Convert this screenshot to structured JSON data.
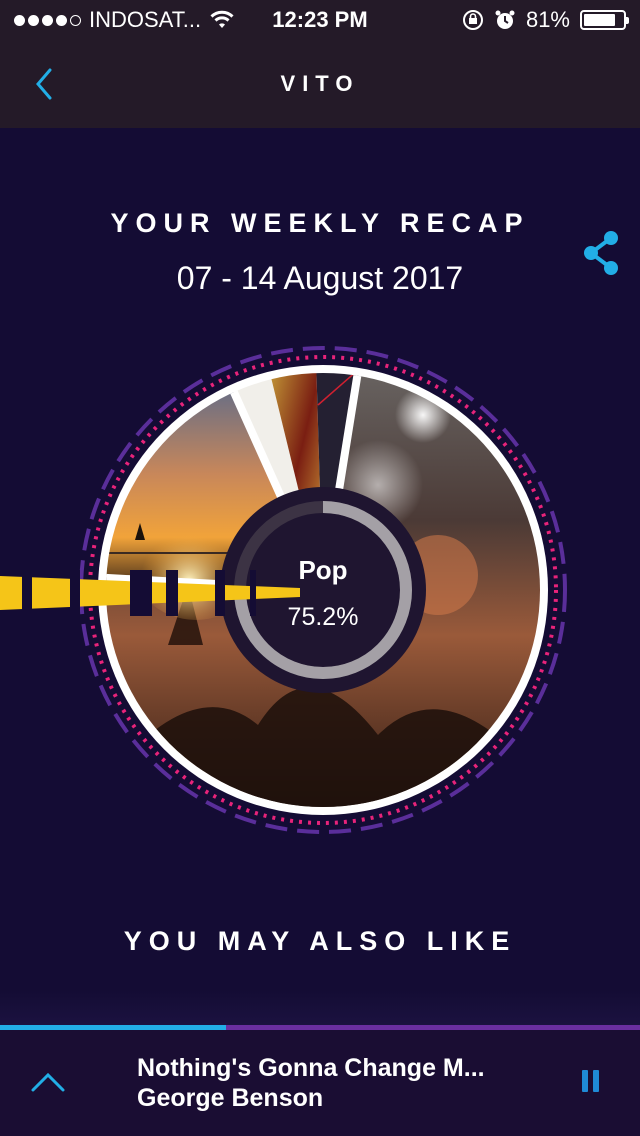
{
  "status": {
    "carrier": "INDOSAT...",
    "time": "12:23 PM",
    "battery": "81%",
    "battery_level": 0.81,
    "signal_bars": 4,
    "icons": [
      "wifi-icon",
      "rotation-lock-icon",
      "alarm-icon"
    ]
  },
  "nav": {
    "title": "VITO",
    "back_icon": "chevron-left-icon"
  },
  "recap": {
    "title": "YOUR WEEKLY RECAP",
    "date_range": "07 - 14 August 2017",
    "share_icon": "share-icon"
  },
  "genre": {
    "name": "Pop",
    "percent": "75.2%",
    "percent_value": 0.752
  },
  "sections": {
    "also_like": "YOU MAY ALSO LIKE"
  },
  "player": {
    "title": "Nothing's Gonna Change M...",
    "artist": "George Benson",
    "progress": 0.353,
    "expand_icon": "chevron-up-icon",
    "pause_icon": "pause-icon"
  },
  "colors": {
    "background": "#140c34",
    "header": "#241a28",
    "accent_blue": "#22aee6",
    "accent_purple": "#6a2fa0",
    "ring_pink": "#e8237a",
    "highlight_yellow": "#f5c518"
  }
}
